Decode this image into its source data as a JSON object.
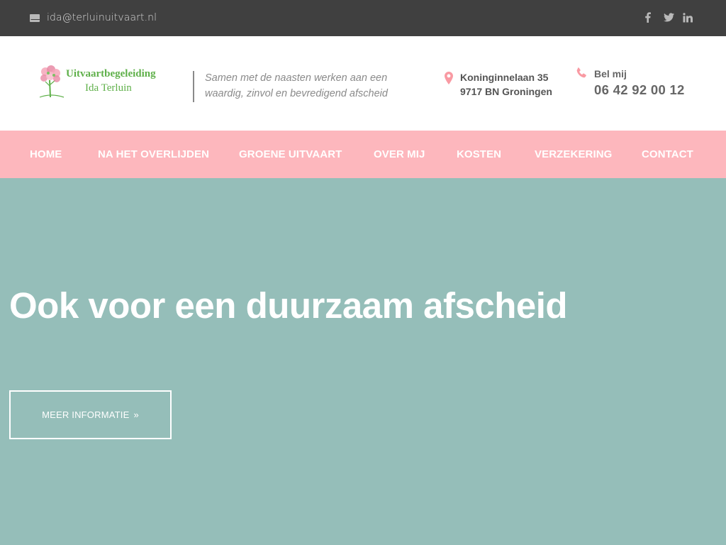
{
  "topbar": {
    "email": "ida@terluinuitvaart.nl",
    "social": [
      "facebook-icon",
      "twitter-icon",
      "linkedin-icon"
    ],
    "background": "#404040"
  },
  "header": {
    "logo": {
      "line1": "Uitvaartbegeleiding",
      "line2": "Ida Terluin"
    },
    "tagline": "Samen met de naasten werken aan een waardig, zinvol en bevredigend afscheid",
    "address": {
      "street": "Koninginnelaan 35",
      "city": "9717 BN Groningen"
    },
    "phone": {
      "label": "Bel mij",
      "number": "06 42 92 00 12"
    }
  },
  "nav": {
    "background": "#fdb7bd",
    "items": [
      {
        "label": "HOME"
      },
      {
        "label": "NA HET OVERLIJDEN"
      },
      {
        "label": "GROENE UITVAART"
      },
      {
        "label": "OVER MIJ"
      },
      {
        "label": "KOSTEN"
      },
      {
        "label": "VERZEKERING"
      },
      {
        "label": "CONTACT"
      }
    ]
  },
  "hero": {
    "background": "#95beb9",
    "headline": "Ook voor een duurzaam afscheid",
    "button_label": "MEER INFORMATIE",
    "button_icon": "double-chevron-right-icon"
  },
  "colors": {
    "accent_pink": "#f99aa3",
    "logo_green": "#5fb04a"
  }
}
